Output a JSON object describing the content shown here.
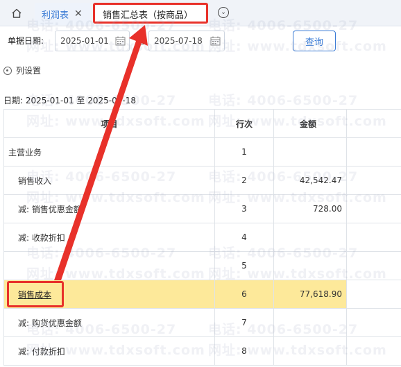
{
  "tabs": {
    "profit_label": "利润表",
    "close_glyph": "✕",
    "sales_label": "销售汇总表（按商品）",
    "menu_glyph": "⌄"
  },
  "filter": {
    "label": "单据日期:",
    "from": "2025-01-01",
    "separator": "至",
    "to": "2025-07-18",
    "query_label": "查询"
  },
  "column_settings_label": "列设置",
  "date_range_text": "日期: 2025-01-01 至 2025-07-18",
  "table": {
    "headers": {
      "item": "项目",
      "seq": "行次",
      "amount": "金额"
    },
    "rows": [
      {
        "item": "主营业务",
        "seq": "1",
        "amount": "",
        "indent": false
      },
      {
        "item": "销售收入",
        "seq": "2",
        "amount": "42,542.47",
        "indent": true
      },
      {
        "item": "减: 销售优惠金额",
        "seq": "3",
        "amount": "728.00",
        "indent": true
      },
      {
        "item": "减: 收款折扣",
        "seq": "4",
        "amount": "",
        "indent": true
      },
      {
        "item": "",
        "seq": "5",
        "amount": "",
        "indent": true
      },
      {
        "item": "销售成本",
        "seq": "6",
        "amount": "77,618.90",
        "indent": true,
        "highlight": true
      },
      {
        "item": "减: 购货优惠金额",
        "seq": "7",
        "amount": "",
        "indent": true
      },
      {
        "item": "减: 付款折扣",
        "seq": "8",
        "amount": "",
        "indent": true
      }
    ]
  },
  "watermark": {
    "phone": "电话: 4006-6500-27",
    "site": "网址: www.tdxsoft.com"
  },
  "colors": {
    "accent": "#3a7bd5",
    "annotation_red": "#e8312a",
    "highlight_row": "#fde99a"
  }
}
